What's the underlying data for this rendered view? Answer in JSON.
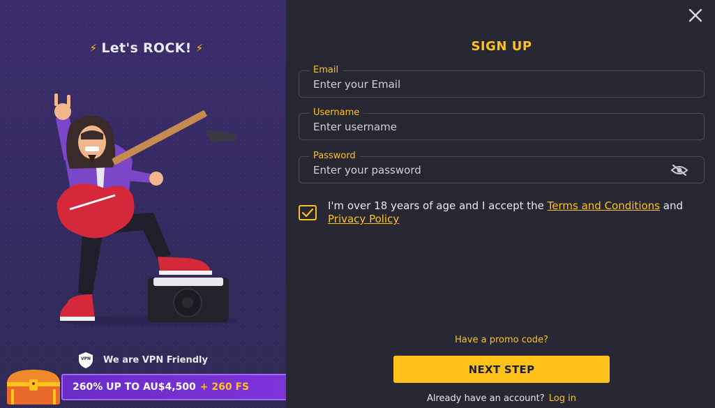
{
  "left": {
    "tagline": "Let's ROCK!",
    "vpn_text": "We are VPN Friendly",
    "vpn_badge": "VPN",
    "bonus_text": "260% UP TO AU$4,500",
    "bonus_extra": "+ 260 FS"
  },
  "form": {
    "title": "SIGN UP",
    "email_label": "Email",
    "email_placeholder": "Enter your Email",
    "username_label": "Username",
    "username_placeholder": "Enter username",
    "password_label": "Password",
    "password_placeholder": "Enter your password",
    "agree_prefix": "I'm over 18 years of age and I accept the",
    "terms_link": "Terms and Conditions",
    "agree_and": "and",
    "privacy_link": "Privacy Policy",
    "agree_checked": true,
    "promo_link": "Have a promo code?",
    "next_button": "NEXT STEP",
    "account_text": "Already have an account?",
    "login_link": "Log in"
  },
  "colors": {
    "accent": "#ffc21a",
    "background": "#272833",
    "panel": "#3a2d6b",
    "banner": "#6a2bc9"
  },
  "icons": [
    "close-icon",
    "bolt-icon",
    "vpn-shield-icon",
    "eye-off-icon",
    "checkmark-icon",
    "treasure-chest-icon"
  ]
}
